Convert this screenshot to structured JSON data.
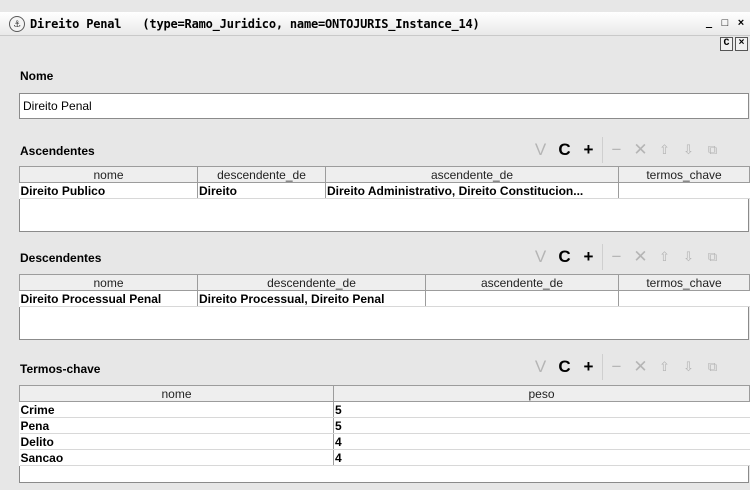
{
  "window": {
    "title": "Direito Penal   (type=Ramo_Juridico, name=ONTOJURIS_Instance_14)",
    "controls": [
      "_",
      "□",
      "×"
    ],
    "sub_controls": [
      "C",
      "×"
    ]
  },
  "nome": {
    "label": "Nome",
    "value": "Direito Penal"
  },
  "toolbar": {
    "icons": [
      "V",
      "C",
      "+",
      "−",
      "✕",
      "⇧",
      "⇩",
      "⧉"
    ]
  },
  "ascendentes": {
    "label": "Ascendentes",
    "columns": [
      "nome",
      "descendente_de",
      "ascendente_de",
      "termos_chave"
    ],
    "rows": [
      [
        "Direito Publico",
        "Direito",
        "Direito Administrativo, Direito Constitucion...",
        ""
      ]
    ]
  },
  "descendentes": {
    "label": "Descendentes",
    "columns": [
      "nome",
      "descendente_de",
      "ascendente_de",
      "termos_chave"
    ],
    "rows": [
      [
        "Direito Processual Penal",
        "Direito Processual, Direito Penal",
        "",
        ""
      ]
    ]
  },
  "termos": {
    "label": "Termos-chave",
    "columns": [
      "nome",
      "peso"
    ],
    "rows": [
      [
        "Crime",
        "5"
      ],
      [
        "Pena",
        "5"
      ],
      [
        "Delito",
        "4"
      ],
      [
        "Sancao",
        "4"
      ]
    ]
  }
}
